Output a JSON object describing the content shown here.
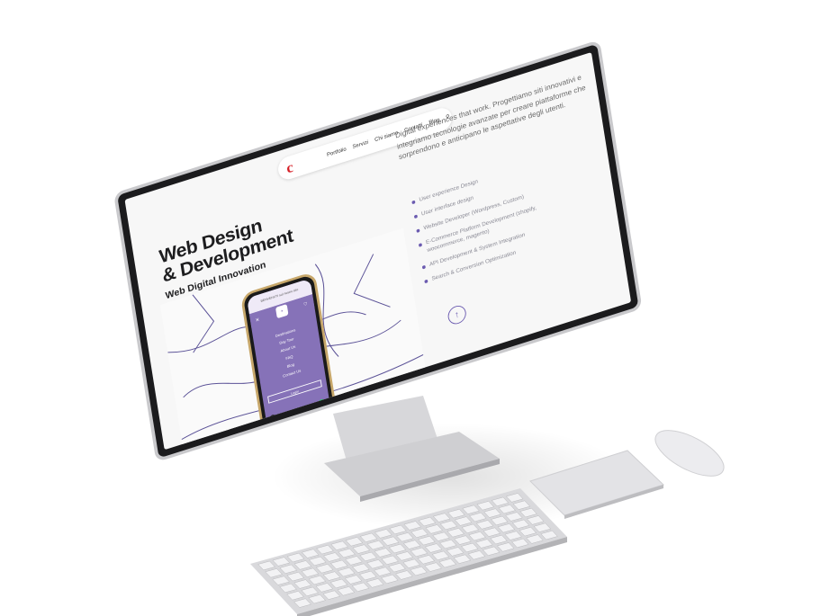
{
  "site": {
    "logo": "c",
    "nav": [
      "Portfolio",
      "Servizi",
      "Chi siamo",
      "Contatti",
      "Blog"
    ],
    "heading_line1": "Web Design",
    "heading_line2": "& Development",
    "subheading": "Web Digital Innovation",
    "intro": "Digital experiences that work. Progettiamo siti innovativi e integriamo tecnologie avanzate per creare piattaforme che sorprendono e anticipano le aspettative degli utenti.",
    "services": [
      "User experience Design",
      "User interface design",
      "Website Developer (Wordpress, Custom)",
      "E-Commerce Platform Development (shopify, woocommerce, magento)",
      "API Development & System Integration",
      "Search & Conversion Optimization"
    ],
    "up_button": "↑"
  },
  "phone": {
    "topbar": "BENVENUTI sul nostro sito",
    "menu": [
      "Destinations",
      "Day Tour",
      "About Us",
      "FAQ",
      "Blog",
      "Contact Us"
    ],
    "login_label": "Login",
    "bottom_url": "ilgiardinesano.com"
  },
  "colors": {
    "accent": "#6b5bb0",
    "logo_red": "#d61f26",
    "phone_purple": "#8672b8"
  }
}
